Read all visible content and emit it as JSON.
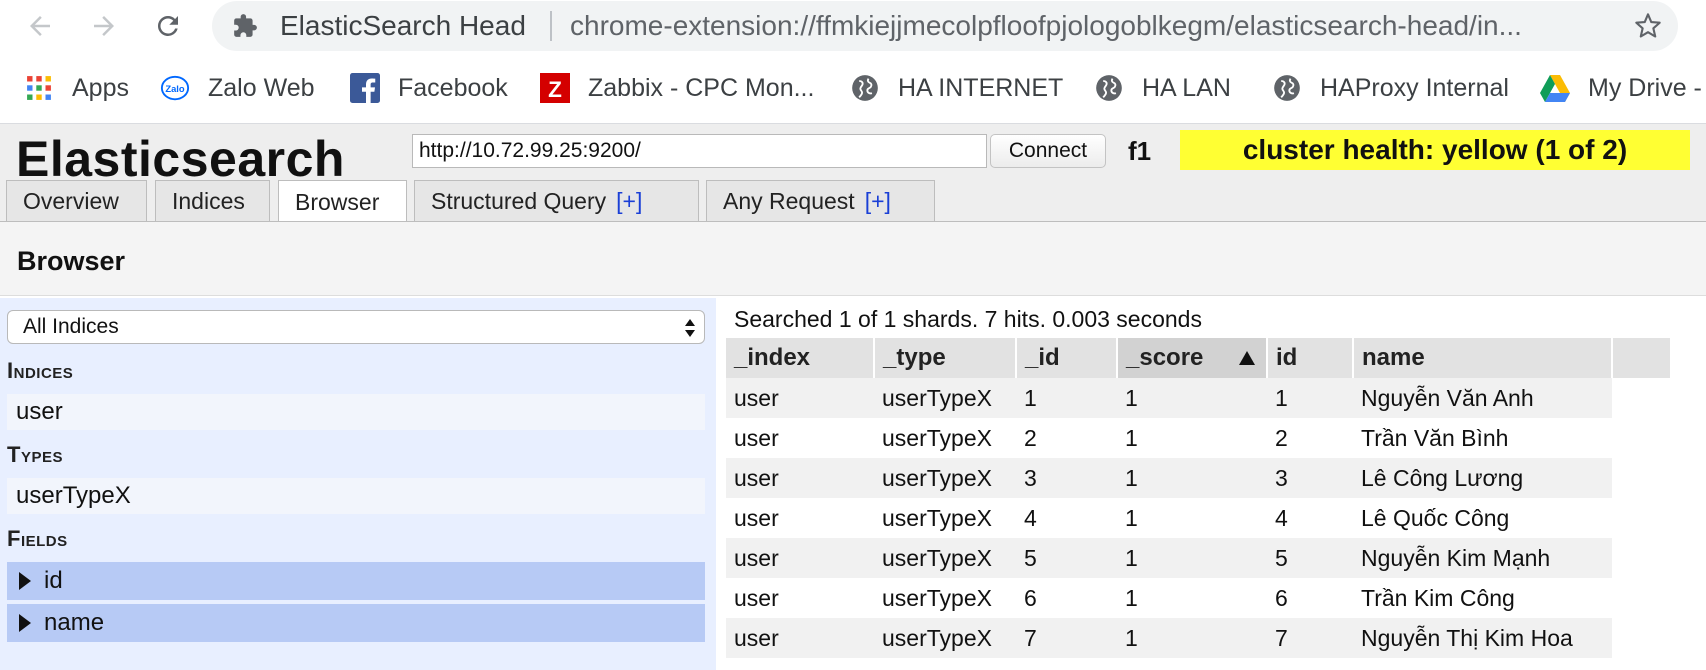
{
  "browser": {
    "tab_title": "ElasticSearch Head",
    "url": "chrome-extension://ffmkiejjmecolpfloofpjologoblkegm/elasticsearch-head/in...",
    "bookmarks": [
      {
        "label": "Apps",
        "icon": "apps-grid-icon"
      },
      {
        "label": "Zalo Web",
        "icon": "zalo-icon"
      },
      {
        "label": "Facebook",
        "icon": "facebook-icon"
      },
      {
        "label": "Zabbix - CPC Mon...",
        "icon": "zabbix-icon"
      },
      {
        "label": "HA INTERNET",
        "icon": "globe-icon"
      },
      {
        "label": "HA LAN",
        "icon": "globe-icon"
      },
      {
        "label": "HAProxy Internal",
        "icon": "globe-icon"
      },
      {
        "label": "My Drive -",
        "icon": "google-drive-icon"
      }
    ]
  },
  "app": {
    "title": "Elasticsearch",
    "connection_url": "http://10.72.99.25:9200/",
    "connect_label": "Connect",
    "cluster_name": "f1",
    "cluster_health": "cluster health: yellow (1 of 2)",
    "health_color": "#ffff33"
  },
  "tabs": [
    {
      "label": "Overview",
      "plus": ""
    },
    {
      "label": "Indices",
      "plus": ""
    },
    {
      "label": "Browser",
      "plus": "",
      "active": true
    },
    {
      "label": "Structured Query",
      "plus": "[+]"
    },
    {
      "label": "Any Request",
      "plus": "[+]"
    }
  ],
  "section_title": "Browser",
  "filters": {
    "index_select": "All Indices",
    "indices_heading": "Indices",
    "indices": [
      "user"
    ],
    "types_heading": "Types",
    "types": [
      "userTypeX"
    ],
    "fields_heading": "Fields",
    "fields": [
      "id",
      "name"
    ]
  },
  "results": {
    "summary": "Searched 1 of 1 shards. 7 hits. 0.003 seconds",
    "columns": [
      "_index",
      "_type",
      "_id",
      "_score",
      "id",
      "name"
    ],
    "sorted_column": "_score",
    "rows": [
      [
        "user",
        "userTypeX",
        "1",
        "1",
        "1",
        "Nguyễn Văn Anh"
      ],
      [
        "user",
        "userTypeX",
        "2",
        "1",
        "2",
        "Trần Văn Bình"
      ],
      [
        "user",
        "userTypeX",
        "3",
        "1",
        "3",
        "Lê Công Lương"
      ],
      [
        "user",
        "userTypeX",
        "4",
        "1",
        "4",
        "Lê Quốc Công"
      ],
      [
        "user",
        "userTypeX",
        "5",
        "1",
        "5",
        "Nguyễn Kim Mạnh"
      ],
      [
        "user",
        "userTypeX",
        "6",
        "1",
        "6",
        "Trần Kim Công"
      ],
      [
        "user",
        "userTypeX",
        "7",
        "1",
        "7",
        "Nguyễn Thị Kim Hoa"
      ]
    ]
  }
}
